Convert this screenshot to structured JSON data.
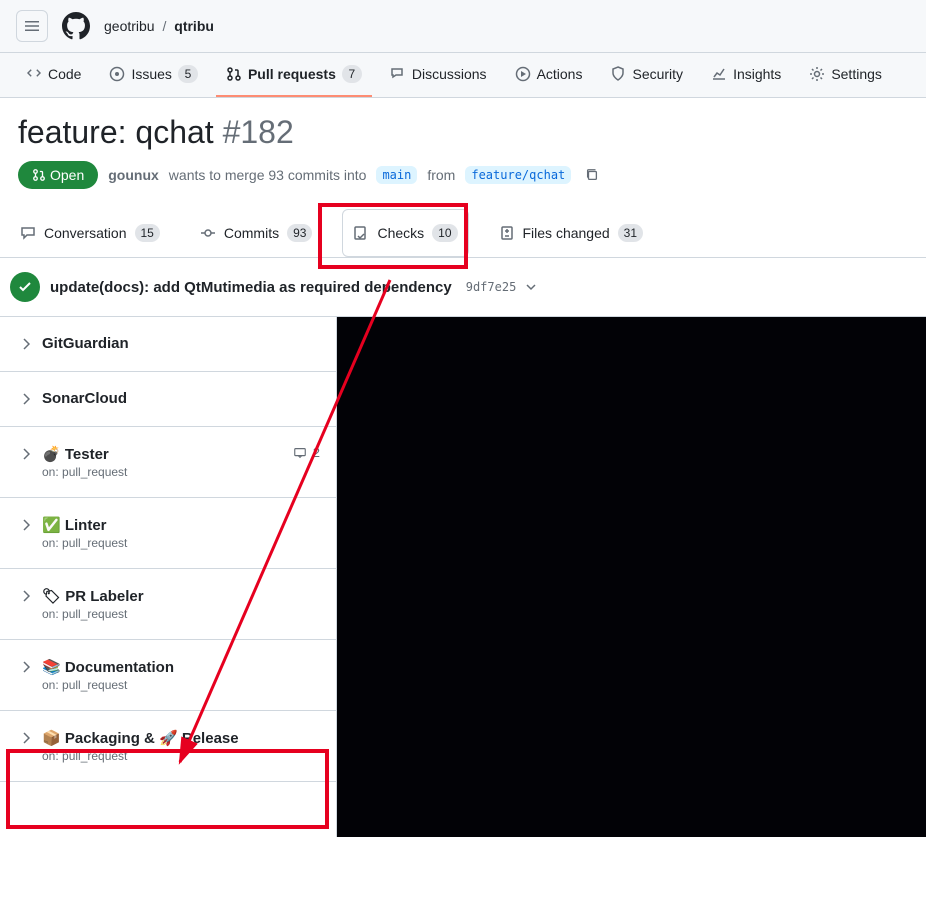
{
  "breadcrumb": {
    "owner": "geotribu",
    "repo": "qtribu"
  },
  "nav": {
    "code": "Code",
    "issues": "Issues",
    "issues_count": "5",
    "prs": "Pull requests",
    "prs_count": "7",
    "discussions": "Discussions",
    "actions": "Actions",
    "security": "Security",
    "insights": "Insights",
    "settings": "Settings"
  },
  "pr": {
    "title": "feature: qchat",
    "number": "#182",
    "state": "Open",
    "author": "gounux",
    "merge_text_1": "wants to merge 93 commits into",
    "base": "main",
    "from": "from",
    "head": "feature/qchat"
  },
  "pr_tabs": {
    "conversation": "Conversation",
    "conversation_count": "15",
    "commits": "Commits",
    "commits_count": "93",
    "checks": "Checks",
    "checks_count": "10",
    "files": "Files changed",
    "files_count": "31"
  },
  "commit": {
    "message": "update(docs): add QtMutimedia as required dependency",
    "sha": "9df7e25"
  },
  "checks": [
    {
      "name": "GitGuardian",
      "sub": "",
      "meta": ""
    },
    {
      "name": "SonarCloud",
      "sub": "",
      "meta": ""
    },
    {
      "name": "💣 Tester",
      "sub": "on: pull_request",
      "meta": "2"
    },
    {
      "name": "✅ Linter",
      "sub": "on: pull_request",
      "meta": ""
    },
    {
      "name": "🏷 PR Labeler",
      "sub": "on: pull_request",
      "meta": ""
    },
    {
      "name": "📚 Documentation",
      "sub": "on: pull_request",
      "meta": ""
    },
    {
      "name": "📦 Packaging & 🚀 Release",
      "sub": "on: pull_request",
      "meta": ""
    }
  ]
}
